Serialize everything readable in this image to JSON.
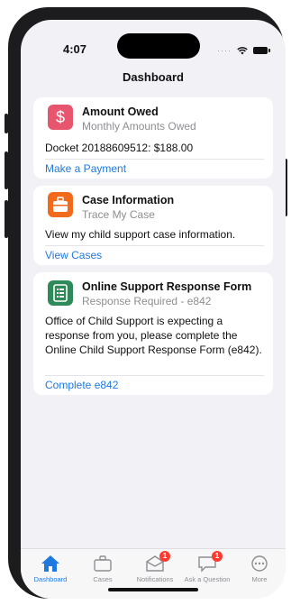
{
  "status": {
    "time": "4:07",
    "dots": "····"
  },
  "nav": {
    "title": "Dashboard"
  },
  "cards": [
    {
      "title": "Amount Owed",
      "subtitle": "Monthly Amounts Owed",
      "body": "Docket 20188609512: $188.00",
      "link": "Make a Payment",
      "icon": "dollar-sign-icon",
      "icon_color": "#e8556f"
    },
    {
      "title": "Case Information",
      "subtitle": "Trace My Case",
      "body": "View my child support case information.",
      "link": "View Cases",
      "icon": "briefcase-icon",
      "icon_color": "#f26a1b"
    },
    {
      "title": "Online Support Response Form",
      "subtitle": "Response Required - e842",
      "body": "Office of Child Support is expecting a response from you, please complete the Online Child Support Response Form (e842).",
      "link": "Complete e842",
      "icon": "form-icon",
      "icon_color": "#2f8a5a"
    }
  ],
  "tabs": [
    {
      "label": "Dashboard",
      "icon": "home-icon",
      "active": true
    },
    {
      "label": "Cases",
      "icon": "briefcase-icon",
      "badge": ""
    },
    {
      "label": "Notifications",
      "icon": "mail-icon",
      "badge": "1"
    },
    {
      "label": "Ask a Question",
      "icon": "chat-icon",
      "badge": "1"
    },
    {
      "label": "More",
      "icon": "more-icon"
    }
  ],
  "colors": {
    "accent": "#1f7ae0",
    "badge": "#ff3b30",
    "background": "#f2f1f6"
  }
}
